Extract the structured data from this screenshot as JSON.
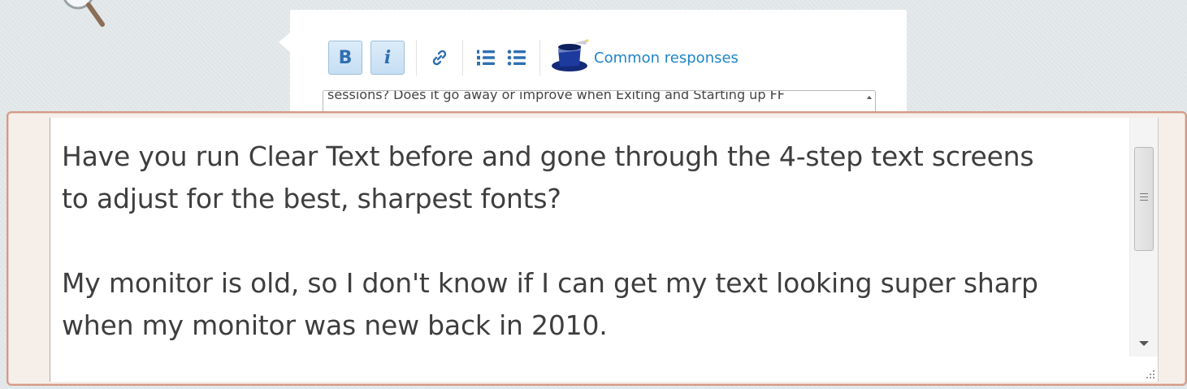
{
  "toolbar": {
    "bold_label": "B",
    "italic_label": "i",
    "link_icon": "link-icon",
    "ordered_list_icon": "ordered-list-icon",
    "unordered_list_icon": "unordered-list-icon",
    "common_responses_label": "Common responses",
    "common_responses_icon": "magic-hat-icon"
  },
  "reply_box": {
    "visible_text": "sessions?  Does it go away or improve when Exiting and Starting up FF"
  },
  "zoomed_editor": {
    "paragraph_1_line_1": "Have you run Clear Text before and gone through the 4-step text screens",
    "paragraph_1_line_2": "to adjust for the best, sharpest fonts?",
    "paragraph_2_line_1": "My monitor is old, so I don't know if I can get my text looking super sharp",
    "paragraph_2_line_2": "when my monitor was new back in 2010."
  },
  "colors": {
    "accent_link": "#1f85c8",
    "button_fill": "#c6def3",
    "zoom_border": "#d49a85",
    "page_bg": "#e3e8ea"
  }
}
